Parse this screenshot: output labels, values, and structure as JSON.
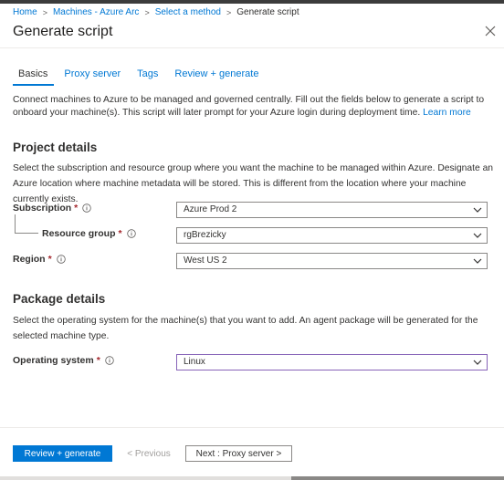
{
  "breadcrumb": {
    "items": [
      {
        "label": "Home"
      },
      {
        "label": "Machines - Azure Arc"
      },
      {
        "label": "Select a method"
      },
      {
        "label": "Generate script"
      }
    ],
    "separator": ">"
  },
  "header": {
    "title": "Generate script"
  },
  "tabs": [
    {
      "label": "Basics",
      "active": true
    },
    {
      "label": "Proxy server"
    },
    {
      "label": "Tags"
    },
    {
      "label": "Review + generate"
    }
  ],
  "intro": {
    "text": "Connect machines to Azure to be managed and governed centrally. Fill out the fields below to generate a script to onboard your machine(s). This script will later prompt for your Azure login during deployment time. ",
    "link": "Learn more"
  },
  "project": {
    "title": "Project details",
    "description": "Select the subscription and resource group where you want the machine to be managed within Azure. Designate an Azure location where machine metadata will be stored. This is different from the location where your machine currently exists.",
    "subscription": {
      "label": "Subscription",
      "required": "*",
      "value": "Azure Prod 2"
    },
    "resource_group": {
      "label": "Resource group",
      "required": "*",
      "value": "rgBrezicky"
    },
    "region": {
      "label": "Region",
      "required": "*",
      "value": "West US 2"
    }
  },
  "package": {
    "title": "Package details",
    "description": "Select the operating system for the machine(s) that you want to add. An agent package will be generated for the selected machine type.",
    "os": {
      "label": "Operating system",
      "required": "*",
      "value": "Linux"
    }
  },
  "footer": {
    "review_label": "Review + generate",
    "previous_label": "< Previous",
    "next_label": "Next : Proxy server >"
  },
  "colors": {
    "accent": "#0078d4",
    "required": "#a4262c",
    "focus": "#8764b8"
  },
  "icons": {
    "info": "info-icon",
    "chevron": "chevron-down-icon",
    "close": "close-icon"
  }
}
